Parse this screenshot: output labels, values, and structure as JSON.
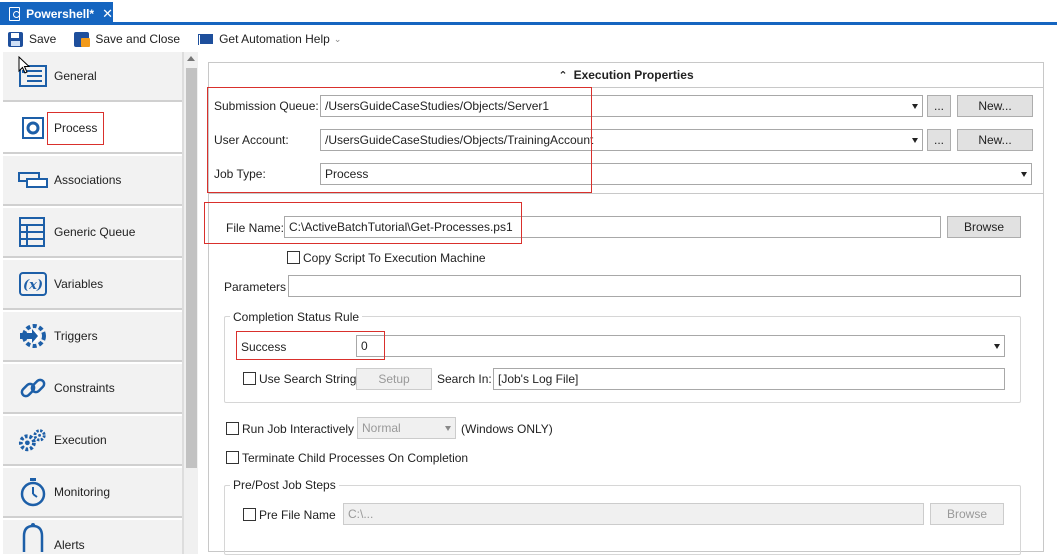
{
  "tab": {
    "title": "Powershell*",
    "close": "✕"
  },
  "toolbar": {
    "save": "Save",
    "save_close": "Save and Close",
    "help": "Get Automation Help",
    "dropdown_glyph": "⌄"
  },
  "sidebar": {
    "items": [
      {
        "label": "General",
        "icon": "general-icon"
      },
      {
        "label": "Process",
        "icon": "gear-icon"
      },
      {
        "label": "Associations",
        "icon": "associations-icon"
      },
      {
        "label": "Generic Queue",
        "icon": "queue-icon"
      },
      {
        "label": "Variables",
        "icon": "variables-icon"
      },
      {
        "label": "Triggers",
        "icon": "triggers-icon"
      },
      {
        "label": "Constraints",
        "icon": "link-icon"
      },
      {
        "label": "Execution",
        "icon": "gears-icon"
      },
      {
        "label": "Monitoring",
        "icon": "stopwatch-icon"
      },
      {
        "label": "Alerts",
        "icon": "bell-icon"
      }
    ]
  },
  "exec": {
    "header": "Execution Properties",
    "header_icon": "⌃",
    "submission_queue_label": "Submission Queue:",
    "submission_queue_value": "/UsersGuideCaseStudies/Objects/Server1",
    "user_account_label": "User Account:",
    "user_account_value": "/UsersGuideCaseStudies/Objects/TrainingAccount",
    "job_type_label": "Job Type:",
    "job_type_value": "Process",
    "ellipsis": "...",
    "new": "New..."
  },
  "process": {
    "file_name_label": "File Name:",
    "file_name_value": "C:\\ActiveBatchTutorial\\Get-Processes.ps1",
    "browse": "Browse",
    "copy_script": "Copy Script To Execution Machine",
    "parameters_label": "Parameters",
    "parameters_value": ""
  },
  "completion": {
    "title": "Completion Status Rule",
    "success_label": "Success",
    "success_value": "0",
    "use_search": "Use Search String",
    "setup": "Setup",
    "search_in_label": "Search In:",
    "search_in_value": "[Job's Log File]"
  },
  "interactive": {
    "run_label": "Run Job Interactively",
    "mode": "Normal",
    "note": "(Windows ONLY)",
    "terminate": "Terminate Child Processes On Completion"
  },
  "prepost": {
    "title": "Pre/Post Job Steps",
    "pre_label": "Pre File Name",
    "pre_placeholder": "C:\\...",
    "browse": "Browse"
  },
  "colors": {
    "accent": "#1565c0",
    "highlight": "#d9302c"
  }
}
